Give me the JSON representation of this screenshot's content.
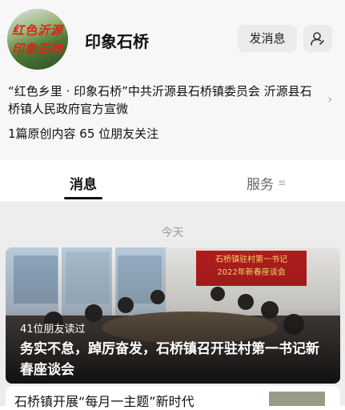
{
  "account": {
    "name": "印象石桥",
    "avatar_line1": "红色沂源",
    "avatar_line2": "印象石桥",
    "send_message_label": "发消息",
    "description": "“红色乡里 · 印象石桥”中共沂源县石桥镇委员会 沂源县石桥镇人民政府官方宣微",
    "stats": "1篇原创内容  65 位朋友关注"
  },
  "tabs": {
    "messages": "消息",
    "services": "服务"
  },
  "feed": {
    "date_label": "今天",
    "article": {
      "banner_text_line1": "石桥镇驻村第一书记",
      "banner_text_line2": "2022年新春座谈会",
      "read_count": "41位朋友读过",
      "title": "务实不怠，踔厉奋发，石桥镇召开驻村第一书记新春座谈会"
    },
    "next_article_title": "石桥镇开展“每月一主题”新时代"
  }
}
